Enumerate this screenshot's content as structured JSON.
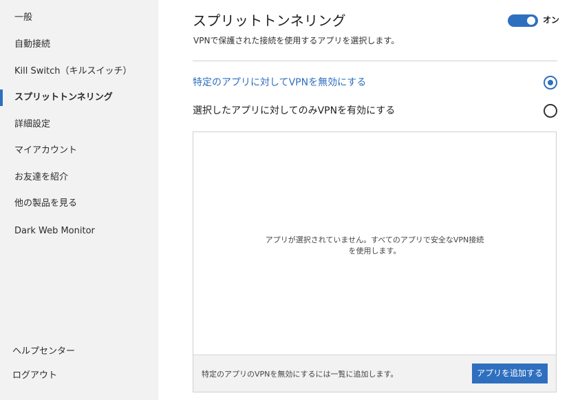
{
  "sidebar": {
    "items": [
      {
        "label": "一般"
      },
      {
        "label": "自動接続"
      },
      {
        "label": "Kill Switch（キルスイッチ）"
      },
      {
        "label": "スプリットトンネリング"
      },
      {
        "label": "詳細設定"
      },
      {
        "label": "マイアカウント"
      },
      {
        "label": "お友達を紹介"
      },
      {
        "label": "他の製品を見る"
      },
      {
        "label": "Dark Web Monitor"
      }
    ],
    "active_index": 3,
    "bottom_items": [
      {
        "label": "ヘルプセンター"
      },
      {
        "label": "ログアウト"
      }
    ]
  },
  "main": {
    "title": "スプリットトンネリング",
    "subtitle": "VPNで保護された接続を使用するアプリを選択します。",
    "toggle": {
      "state": "on",
      "label": "オン"
    },
    "options": [
      {
        "label": "特定のアプリに対してVPNを無効にする",
        "selected": true
      },
      {
        "label": "選択したアプリに対してのみVPNを有効にする",
        "selected": false
      }
    ],
    "app_panel": {
      "empty_line1": "アプリが選択されていません。すべてのアプリで安全なVPN接続",
      "empty_line2": "を使用します。",
      "footer_hint": "特定のアプリのVPNを無効にするには一覧に追加します。",
      "add_button_label": "アプリを追加する"
    }
  },
  "colors": {
    "accent": "#2f6fbf",
    "sidebar_bg": "#f2f2f2"
  }
}
